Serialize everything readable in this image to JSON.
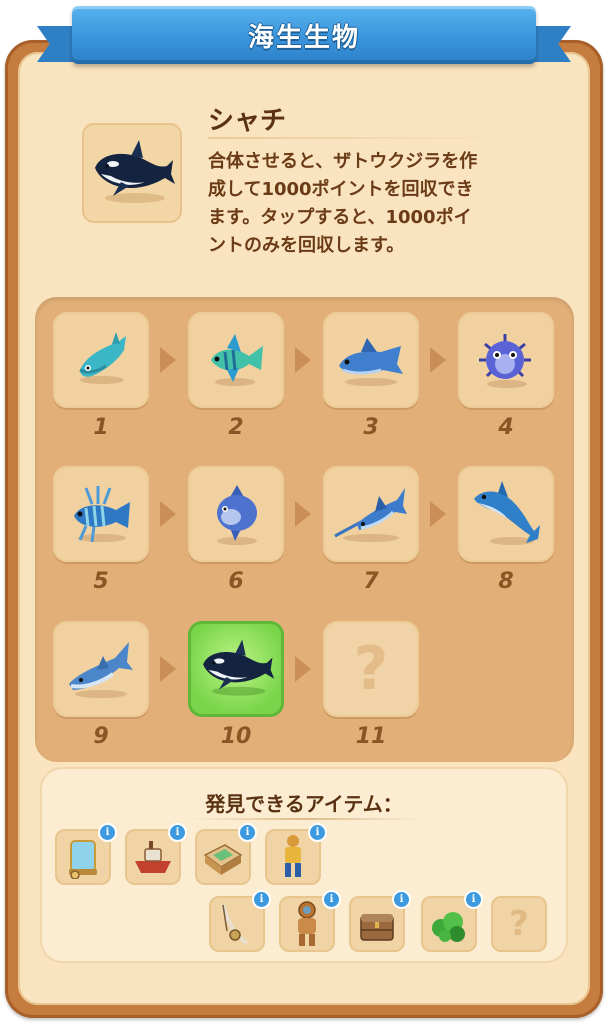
{
  "title": "海生生物",
  "item": {
    "name": "シャチ",
    "description_lines": [
      "合体させると、ザトウクジラを作",
      "成して1000ポイントを回収でき",
      "ます。タップすると、1000ポイ",
      "ントのみを回収します。"
    ]
  },
  "chain": [
    {
      "level": "1",
      "icon": "catfish-icon"
    },
    {
      "level": "2",
      "icon": "angelfish-icon"
    },
    {
      "level": "3",
      "icon": "wolf-fish-icon"
    },
    {
      "level": "4",
      "icon": "pufferfish-icon"
    },
    {
      "level": "5",
      "icon": "lionfish-icon"
    },
    {
      "level": "6",
      "icon": "sunfish-icon"
    },
    {
      "level": "7",
      "icon": "swordfish-icon"
    },
    {
      "level": "8",
      "icon": "dolphin-icon"
    },
    {
      "level": "9",
      "icon": "shark-icon"
    },
    {
      "level": "10",
      "icon": "orca-icon",
      "selected": true
    },
    {
      "level": "11",
      "icon": "unknown-icon",
      "unknown_glyph": "?"
    }
  ],
  "discover": {
    "title": "発見できるアイテム：",
    "items": [
      {
        "icon": "aquarium-tank-icon",
        "badge": "i"
      },
      {
        "icon": "boat-icon",
        "badge": "i"
      },
      {
        "icon": "box-icon",
        "badge": "i"
      },
      {
        "icon": "diver-figure-icon",
        "badge": "i"
      },
      {
        "icon": "fishing-rod-icon",
        "badge": "i"
      },
      {
        "icon": "diving-suit-icon",
        "badge": "i"
      },
      {
        "icon": "treasure-chest-icon",
        "badge": "i"
      },
      {
        "icon": "seaweed-icon",
        "badge": "i"
      },
      {
        "icon": "unknown-icon",
        "glyph": "?"
      }
    ]
  },
  "colors": {
    "ribbon": "#3b95dc",
    "panel_border": "#c67c3e",
    "panel_bg": "#f9e4bf",
    "selected_tile": "#7ad54a",
    "text_brown": "#5a3212",
    "level_number": "#8b5526"
  }
}
